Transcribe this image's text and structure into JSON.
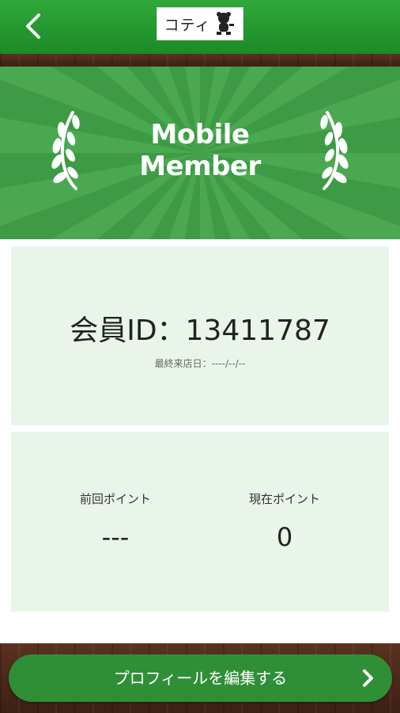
{
  "header": {
    "back_icon": "chevron-left-icon",
    "logo_text": "コティ",
    "logo_icon": "mascot-icon"
  },
  "banner": {
    "title_line1": "Mobile",
    "title_line2": "Member",
    "left_icon": "laurel-left-icon",
    "right_icon": "laurel-right-icon",
    "colors": {
      "ray_light": "#4aa851",
      "ray_dark": "#3d9a45"
    }
  },
  "member": {
    "id_text": "会員ID：13411787",
    "last_visit_text": "最終来店日：----/--/--"
  },
  "points": {
    "previous_label": "前回ポイント",
    "previous_value": "---",
    "current_label": "現在ポイント",
    "current_value": "0"
  },
  "footer": {
    "edit_profile_label": "プロフィールを編集する",
    "chevron_icon": "chevron-right-icon"
  },
  "colors": {
    "header_green": "#2a9c34",
    "card_bg": "#e8f5e8",
    "button_green": "#2f8f36"
  }
}
